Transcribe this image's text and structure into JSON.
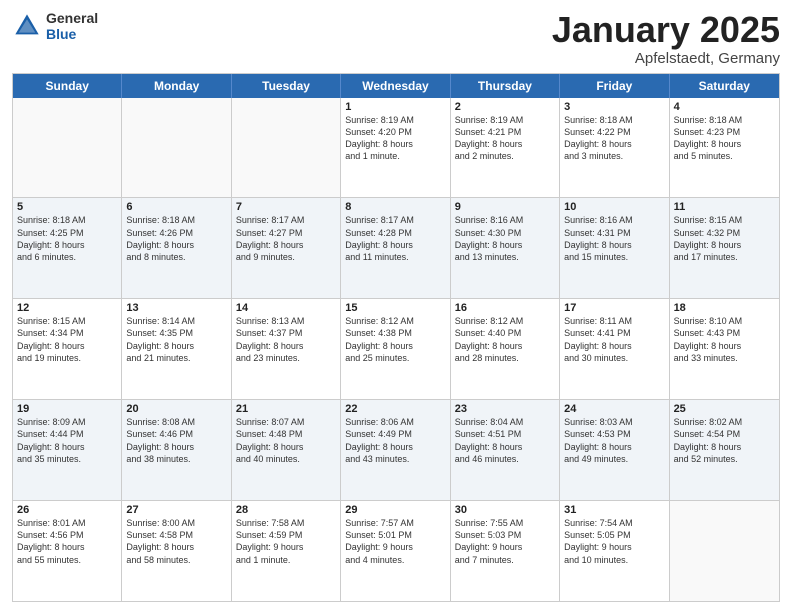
{
  "header": {
    "logo_general": "General",
    "logo_blue": "Blue",
    "title": "January 2025",
    "location": "Apfelstaedt, Germany"
  },
  "weekdays": [
    "Sunday",
    "Monday",
    "Tuesday",
    "Wednesday",
    "Thursday",
    "Friday",
    "Saturday"
  ],
  "rows": [
    [
      {
        "day": "",
        "info": "",
        "empty": true
      },
      {
        "day": "",
        "info": "",
        "empty": true
      },
      {
        "day": "",
        "info": "",
        "empty": true
      },
      {
        "day": "1",
        "info": "Sunrise: 8:19 AM\nSunset: 4:20 PM\nDaylight: 8 hours\nand 1 minute."
      },
      {
        "day": "2",
        "info": "Sunrise: 8:19 AM\nSunset: 4:21 PM\nDaylight: 8 hours\nand 2 minutes."
      },
      {
        "day": "3",
        "info": "Sunrise: 8:18 AM\nSunset: 4:22 PM\nDaylight: 8 hours\nand 3 minutes."
      },
      {
        "day": "4",
        "info": "Sunrise: 8:18 AM\nSunset: 4:23 PM\nDaylight: 8 hours\nand 5 minutes."
      }
    ],
    [
      {
        "day": "5",
        "info": "Sunrise: 8:18 AM\nSunset: 4:25 PM\nDaylight: 8 hours\nand 6 minutes."
      },
      {
        "day": "6",
        "info": "Sunrise: 8:18 AM\nSunset: 4:26 PM\nDaylight: 8 hours\nand 8 minutes."
      },
      {
        "day": "7",
        "info": "Sunrise: 8:17 AM\nSunset: 4:27 PM\nDaylight: 8 hours\nand 9 minutes."
      },
      {
        "day": "8",
        "info": "Sunrise: 8:17 AM\nSunset: 4:28 PM\nDaylight: 8 hours\nand 11 minutes."
      },
      {
        "day": "9",
        "info": "Sunrise: 8:16 AM\nSunset: 4:30 PM\nDaylight: 8 hours\nand 13 minutes."
      },
      {
        "day": "10",
        "info": "Sunrise: 8:16 AM\nSunset: 4:31 PM\nDaylight: 8 hours\nand 15 minutes."
      },
      {
        "day": "11",
        "info": "Sunrise: 8:15 AM\nSunset: 4:32 PM\nDaylight: 8 hours\nand 17 minutes."
      }
    ],
    [
      {
        "day": "12",
        "info": "Sunrise: 8:15 AM\nSunset: 4:34 PM\nDaylight: 8 hours\nand 19 minutes."
      },
      {
        "day": "13",
        "info": "Sunrise: 8:14 AM\nSunset: 4:35 PM\nDaylight: 8 hours\nand 21 minutes."
      },
      {
        "day": "14",
        "info": "Sunrise: 8:13 AM\nSunset: 4:37 PM\nDaylight: 8 hours\nand 23 minutes."
      },
      {
        "day": "15",
        "info": "Sunrise: 8:12 AM\nSunset: 4:38 PM\nDaylight: 8 hours\nand 25 minutes."
      },
      {
        "day": "16",
        "info": "Sunrise: 8:12 AM\nSunset: 4:40 PM\nDaylight: 8 hours\nand 28 minutes."
      },
      {
        "day": "17",
        "info": "Sunrise: 8:11 AM\nSunset: 4:41 PM\nDaylight: 8 hours\nand 30 minutes."
      },
      {
        "day": "18",
        "info": "Sunrise: 8:10 AM\nSunset: 4:43 PM\nDaylight: 8 hours\nand 33 minutes."
      }
    ],
    [
      {
        "day": "19",
        "info": "Sunrise: 8:09 AM\nSunset: 4:44 PM\nDaylight: 8 hours\nand 35 minutes."
      },
      {
        "day": "20",
        "info": "Sunrise: 8:08 AM\nSunset: 4:46 PM\nDaylight: 8 hours\nand 38 minutes."
      },
      {
        "day": "21",
        "info": "Sunrise: 8:07 AM\nSunset: 4:48 PM\nDaylight: 8 hours\nand 40 minutes."
      },
      {
        "day": "22",
        "info": "Sunrise: 8:06 AM\nSunset: 4:49 PM\nDaylight: 8 hours\nand 43 minutes."
      },
      {
        "day": "23",
        "info": "Sunrise: 8:04 AM\nSunset: 4:51 PM\nDaylight: 8 hours\nand 46 minutes."
      },
      {
        "day": "24",
        "info": "Sunrise: 8:03 AM\nSunset: 4:53 PM\nDaylight: 8 hours\nand 49 minutes."
      },
      {
        "day": "25",
        "info": "Sunrise: 8:02 AM\nSunset: 4:54 PM\nDaylight: 8 hours\nand 52 minutes."
      }
    ],
    [
      {
        "day": "26",
        "info": "Sunrise: 8:01 AM\nSunset: 4:56 PM\nDaylight: 8 hours\nand 55 minutes."
      },
      {
        "day": "27",
        "info": "Sunrise: 8:00 AM\nSunset: 4:58 PM\nDaylight: 8 hours\nand 58 minutes."
      },
      {
        "day": "28",
        "info": "Sunrise: 7:58 AM\nSunset: 4:59 PM\nDaylight: 9 hours\nand 1 minute."
      },
      {
        "day": "29",
        "info": "Sunrise: 7:57 AM\nSunset: 5:01 PM\nDaylight: 9 hours\nand 4 minutes."
      },
      {
        "day": "30",
        "info": "Sunrise: 7:55 AM\nSunset: 5:03 PM\nDaylight: 9 hours\nand 7 minutes."
      },
      {
        "day": "31",
        "info": "Sunrise: 7:54 AM\nSunset: 5:05 PM\nDaylight: 9 hours\nand 10 minutes."
      },
      {
        "day": "",
        "info": "",
        "empty": true
      }
    ]
  ]
}
